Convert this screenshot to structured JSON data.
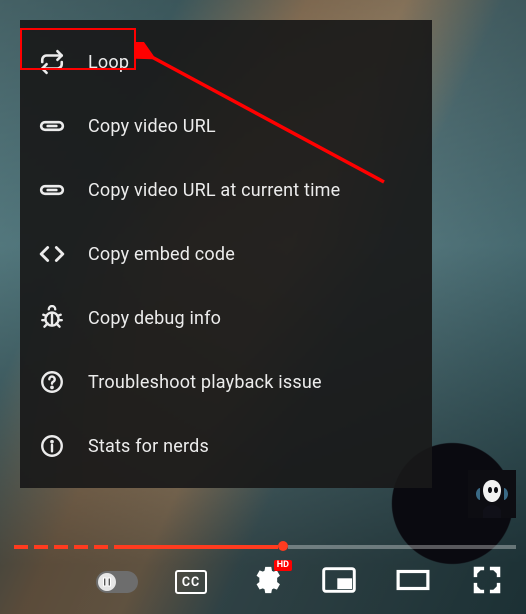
{
  "contextMenu": {
    "items": [
      {
        "name": "loop",
        "label": "Loop",
        "icon": "loop-icon"
      },
      {
        "name": "copy-url",
        "label": "Copy video URL",
        "icon": "link-icon"
      },
      {
        "name": "copy-url-time",
        "label": "Copy video URL at current time",
        "icon": "link-icon"
      },
      {
        "name": "copy-embed",
        "label": "Copy embed code",
        "icon": "embed-icon"
      },
      {
        "name": "copy-debug",
        "label": "Copy debug info",
        "icon": "bug-icon"
      },
      {
        "name": "troubleshoot",
        "label": "Troubleshoot playback issue",
        "icon": "help-icon"
      },
      {
        "name": "stats",
        "label": "Stats for nerds",
        "icon": "info-icon"
      }
    ]
  },
  "annotation": {
    "highlight_item": "loop",
    "highlight_color": "#ff0000"
  },
  "player": {
    "autoplay_on": false,
    "cc_label": "CC",
    "settings_badge": "HD",
    "accent": "#ff3b1f"
  }
}
